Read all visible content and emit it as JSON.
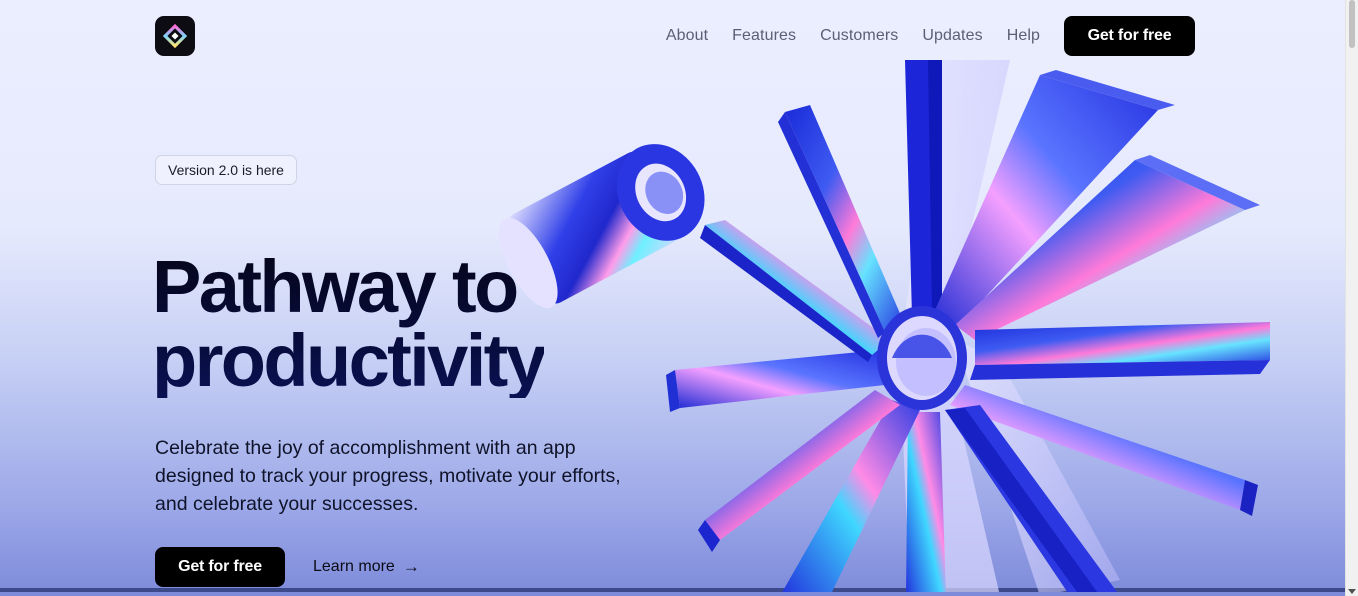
{
  "header": {
    "logo_icon": "diamond-gradient-logo",
    "nav": [
      "About",
      "Features",
      "Customers",
      "Updates",
      "Help"
    ],
    "cta_label": "Get for free"
  },
  "hero": {
    "badge": "Version 2.0 is here",
    "title_line1": "Pathway to",
    "title_line2": "productivity",
    "description": "Celebrate the joy of accomplishment with an app designed to track your progress, motivate your efforts, and celebrate your successes.",
    "primary_cta": "Get for free",
    "secondary_cta": "Learn more",
    "secondary_icon": "arrow-right-icon"
  },
  "colors": {
    "accent_blue": "#2a33d6",
    "button_bg": "#000000",
    "text_dark": "#0a1152"
  }
}
